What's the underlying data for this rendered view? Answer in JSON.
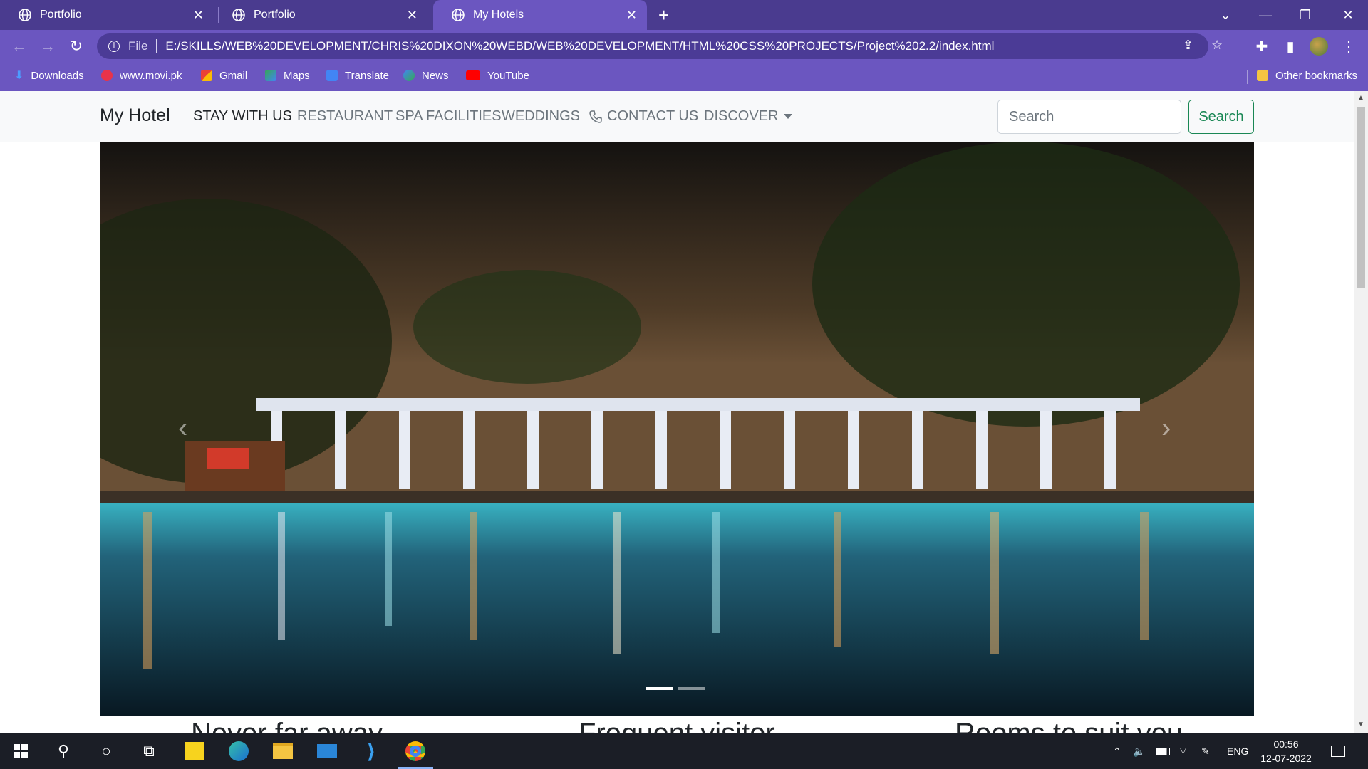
{
  "browser": {
    "tabs": [
      {
        "title": "Portfolio",
        "active": false
      },
      {
        "title": "Portfolio",
        "active": false
      },
      {
        "title": "My Hotels",
        "active": true
      }
    ],
    "address": {
      "scheme_label": "File",
      "url": "E:/SKILLS/WEB%20DEVELOPMENT/CHRIS%20DIXON%20WEBD/WEB%20DEVELOPMENT/HTML%20CSS%20PROJECTS/Project%202.2/index.html"
    },
    "bookmarks": [
      "Downloads",
      "www.movi.pk",
      "Gmail",
      "Maps",
      "Translate",
      "News",
      "YouTube"
    ],
    "other_bookmarks": "Other bookmarks"
  },
  "site": {
    "brand": "My Hotel",
    "nav": [
      {
        "label": "STAY WITH US",
        "active": true
      },
      {
        "label": "RESTAURANT",
        "active": false
      },
      {
        "label": "SPA FACILITIES",
        "active": false
      },
      {
        "label": "WEDDINGS",
        "active": false
      },
      {
        "label": "CONTACT US",
        "active": false,
        "icon": "phone-icon"
      },
      {
        "label": "DISCOVER",
        "active": false,
        "dropdown": true
      }
    ],
    "search": {
      "placeholder": "Search",
      "button": "Search"
    },
    "carousel": {
      "slide_count": 2,
      "active_slide": 1,
      "prev_glyph": "‹",
      "next_glyph": "›"
    },
    "features": [
      "Never far away",
      "Frequent visitor",
      "Rooms to suit you"
    ]
  },
  "taskbar": {
    "lang": "ENG",
    "time": "00:56",
    "date": "12-07-2022"
  },
  "colors": {
    "tabstrip": "#4a3b8f",
    "toolbar": "#6b56c0",
    "search_button": "#198754"
  }
}
